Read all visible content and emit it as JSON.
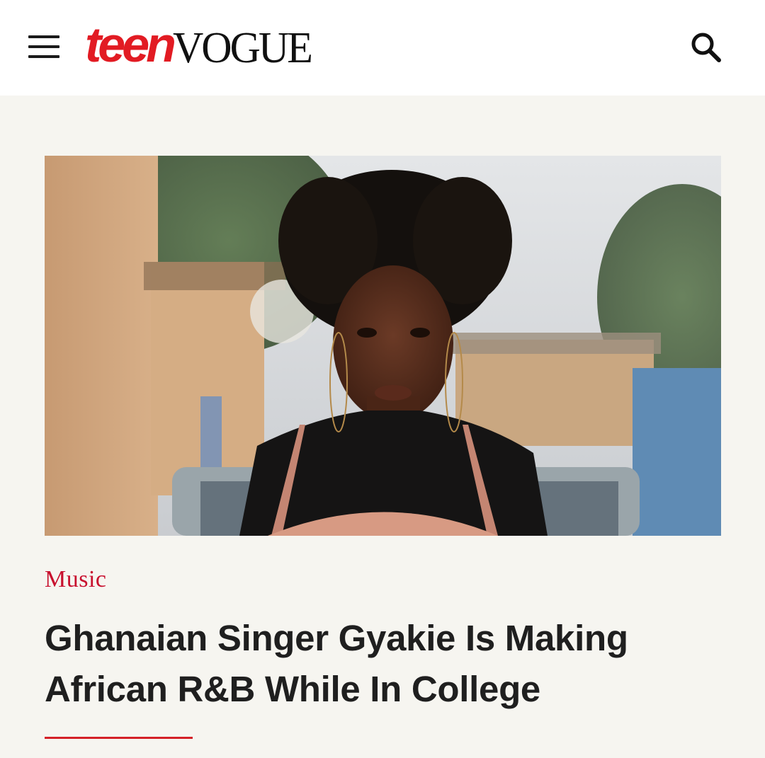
{
  "header": {
    "logo_teen": "teen",
    "logo_vogue": "VOGUE",
    "menu_icon": "hamburger-menu-icon",
    "search_icon": "search-icon"
  },
  "article": {
    "category": "Music",
    "headline": "Ghanaian Singer Gyakie Is Making African R&B While In College",
    "image_subject": "portrait-photo"
  },
  "colors": {
    "brand_red": "#e21b23",
    "category_red": "#c8102e",
    "page_background": "#f6f5f0",
    "header_background": "#ffffff",
    "text_dark": "#1f1f1f"
  }
}
